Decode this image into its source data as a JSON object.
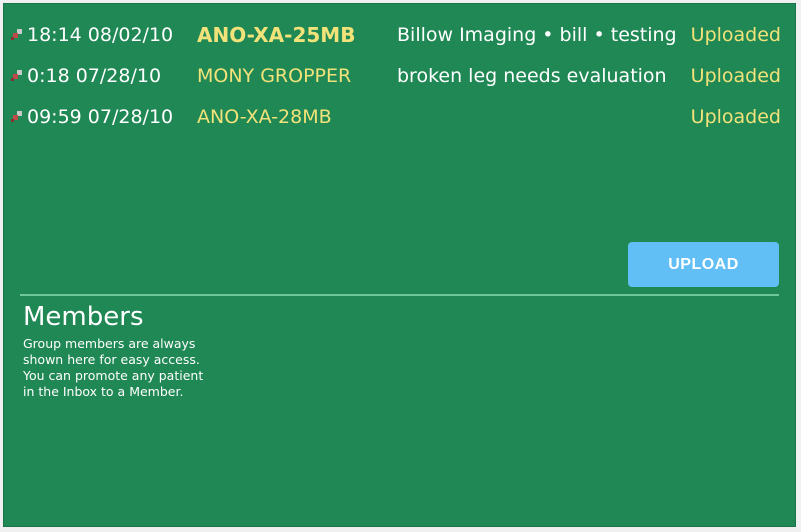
{
  "inbox": {
    "rows": [
      {
        "time": "18:14 08/02/10",
        "ident": "ANO-XA-25MB",
        "description": "Billow Imaging • bill • testing",
        "status": "Uploaded"
      },
      {
        "time": "0:18 07/28/10",
        "ident": "MONY GROPPER",
        "description": "broken leg needs evaluation",
        "status": "Uploaded"
      },
      {
        "time": "09:59 07/28/10",
        "ident": "ANO-XA-28MB",
        "description": "",
        "status": "Uploaded"
      }
    ]
  },
  "upload_button": {
    "label": "UPLOAD"
  },
  "members": {
    "title": "Members",
    "description_lines": [
      "Group members are always",
      "shown here for easy access.",
      "You can promote any patient",
      "in the Inbox to a Member."
    ]
  },
  "colors": {
    "panel_bg": "#1f8854",
    "highlight_text": "#f2e27a",
    "button_bg": "#62bff6"
  },
  "icons": {
    "row_pin": "pushpin-icon"
  }
}
